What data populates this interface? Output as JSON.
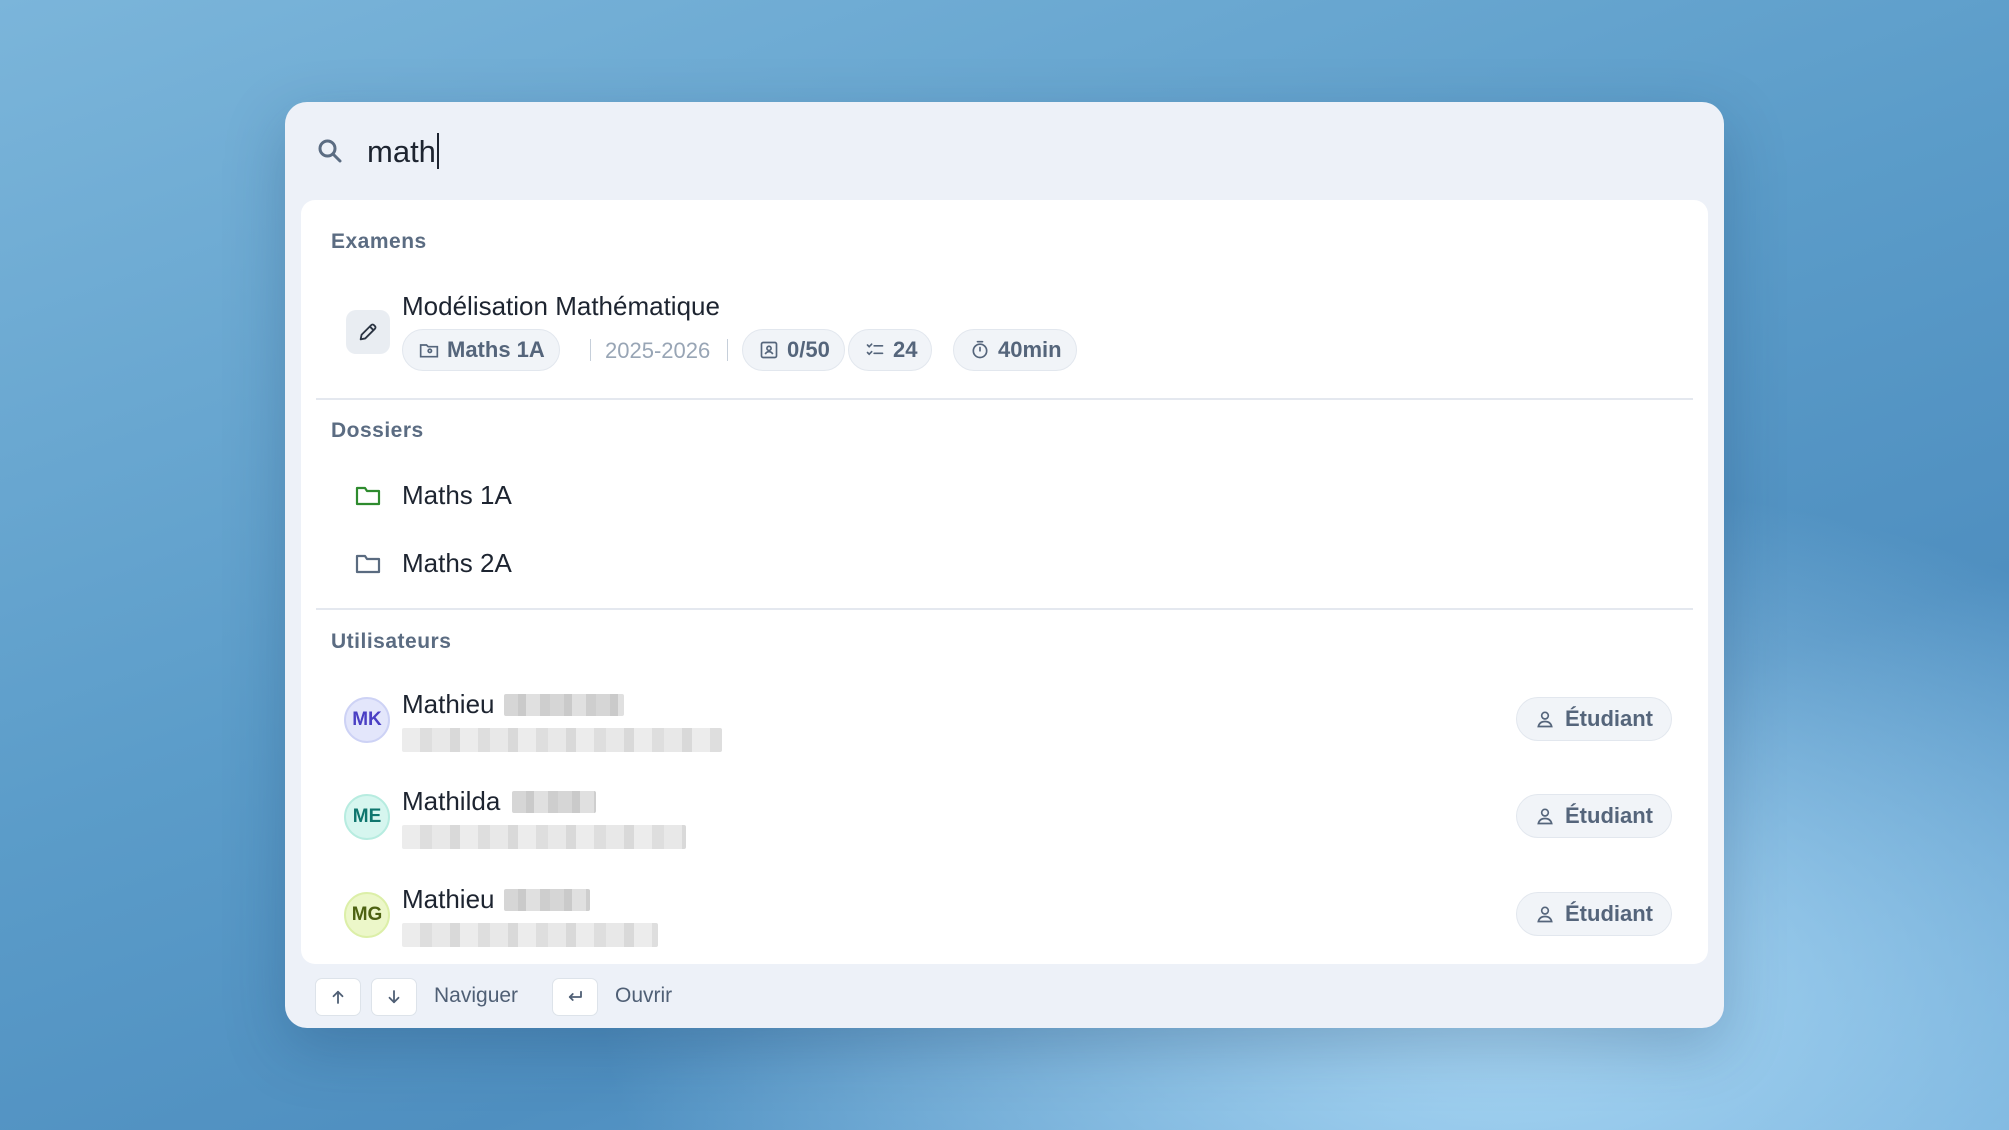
{
  "search": {
    "query": "math"
  },
  "sections": {
    "exams": {
      "title": "Examens",
      "item": {
        "title": "Modélisation Mathématique",
        "folder": "Maths 1A",
        "year": "2025-2026",
        "copies": "0/50",
        "questions": "24",
        "duration": "40min"
      }
    },
    "folders": {
      "title": "Dossiers",
      "items": [
        {
          "label": "Maths 1A",
          "color": "#2e8b2e"
        },
        {
          "label": "Maths 2A",
          "color": "#5a6b80"
        }
      ]
    },
    "users": {
      "title": "Utilisateurs",
      "items": [
        {
          "initials": "MK",
          "first_name": "Mathieu",
          "role": "Étudiant",
          "avatar_bg": "#e3e6fb",
          "avatar_fg": "#4a3fc4"
        },
        {
          "initials": "ME",
          "first_name": "Mathilda",
          "role": "Étudiant",
          "avatar_bg": "#d6f6ef",
          "avatar_fg": "#0f766e"
        },
        {
          "initials": "MG",
          "first_name": "Mathieu",
          "role": "Étudiant",
          "avatar_bg": "#ecf7c9",
          "avatar_fg": "#4d6212"
        }
      ]
    }
  },
  "footer": {
    "navigate_label": "Naviguer",
    "open_label": "Ouvrir"
  },
  "icons": {
    "search": "search-icon",
    "pencil": "pencil-icon",
    "folder": "folder-icon",
    "user": "user-icon",
    "arrow_up": "arrow-up-icon",
    "arrow_down": "arrow-down-icon",
    "enter": "enter-icon"
  }
}
